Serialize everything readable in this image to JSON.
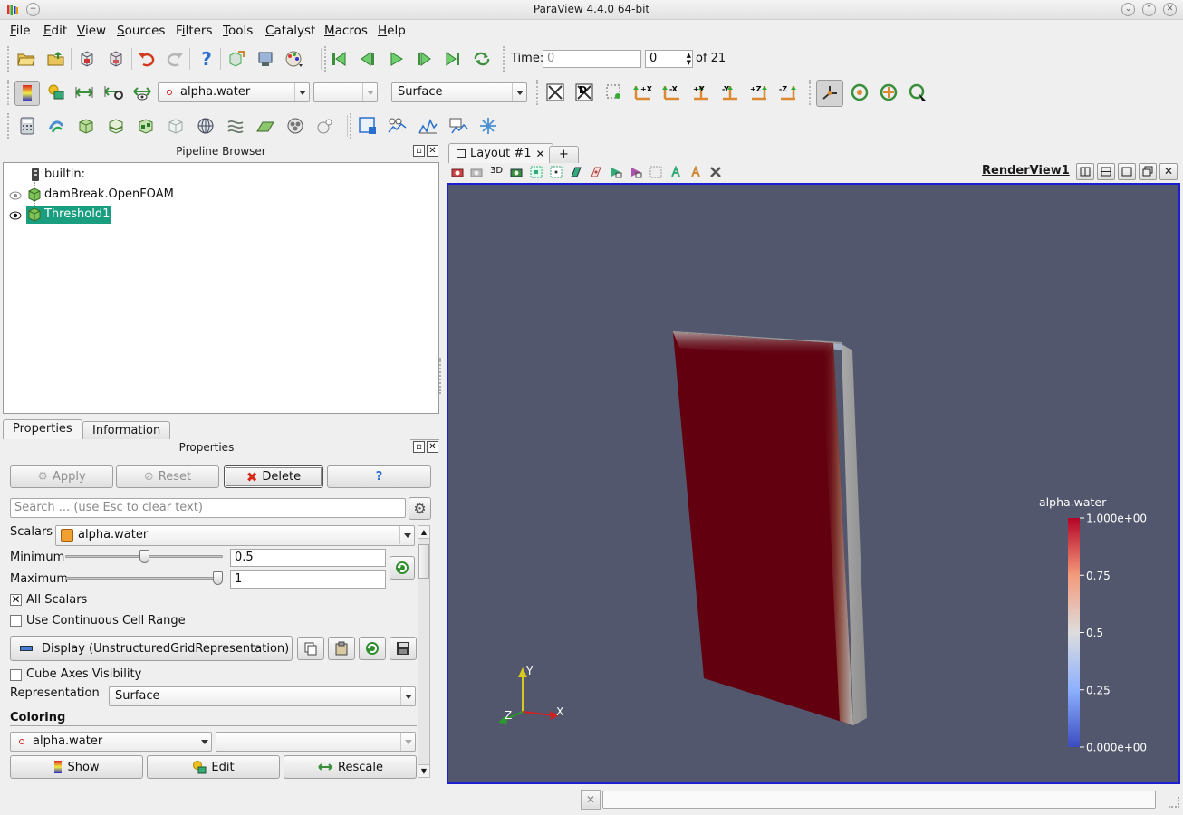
{
  "window": {
    "title": "ParaView 4.4.0 64-bit"
  },
  "menu": [
    "File",
    "Edit",
    "View",
    "Sources",
    "Filters",
    "Tools",
    "Catalyst",
    "Macros",
    "Help"
  ],
  "menu_underline": [
    "F",
    "E",
    "V",
    "S",
    "i",
    "T",
    "C",
    "M",
    "H"
  ],
  "time_toolbar": {
    "time_label": "Time:",
    "time_value": "0",
    "step_value": "0",
    "of_label": "of 21"
  },
  "display_toolbar": {
    "color_by": "alpha.water",
    "component": "",
    "representation": "Surface"
  },
  "pipeline_browser": {
    "title": "Pipeline Browser",
    "items": [
      {
        "label": "builtin:"
      },
      {
        "label": "damBreak.OpenFOAM"
      },
      {
        "label": "Threshold1",
        "selected": true
      }
    ]
  },
  "tabs": {
    "properties": "Properties",
    "information": "Information"
  },
  "properties_panel": {
    "title": "Properties",
    "apply": "Apply",
    "reset": "Reset",
    "delete": "Delete",
    "help": "?",
    "search_placeholder": "Search ... (use Esc to clear text)",
    "scalars_label": "Scalars",
    "scalars_value": "alpha.water",
    "minimum_label": "Minimum",
    "minimum_value": "0.5",
    "maximum_label": "Maximum",
    "maximum_value": "1",
    "minimum_fraction": 0.5,
    "maximum_fraction": 1.0,
    "all_scalars_label": "All Scalars",
    "all_scalars_checked": true,
    "continuous_cell_range_label": "Use Continuous Cell Range",
    "continuous_cell_range_checked": false,
    "display_button": "Display (UnstructuredGridRepresentation)",
    "cube_axes_label": "Cube Axes Visibility",
    "cube_axes_checked": false,
    "representation_label": "Representation",
    "representation_value": "Surface",
    "coloring_title": "Coloring",
    "coloring_value": "alpha.water",
    "coloring_component": "",
    "show_button": "Show",
    "edit_button": "Edit",
    "rescale_button": "Rescale"
  },
  "layout": {
    "tab_label": "Layout #1",
    "add_tab": "+",
    "view_name": "RenderView1",
    "view_mode_label": "3D"
  },
  "scalar_bar": {
    "title": "alpha.water",
    "labels": [
      "1.000e+00",
      "0.75",
      "0.5",
      "0.25",
      "0.000e+00"
    ],
    "values": [
      1.0,
      0.75,
      0.5,
      0.25,
      0.0
    ]
  },
  "orientation_axes": {
    "x": "X",
    "y": "Y",
    "z": "Z"
  },
  "colors": {
    "render_background": "#52576e",
    "active_view_border": "#1b1fd1",
    "selection": "#1a9e80",
    "slab_face": "#62000f",
    "colormap_high": "#b40426",
    "colormap_mid": "#dddddd",
    "colormap_low": "#3b4cc0"
  }
}
